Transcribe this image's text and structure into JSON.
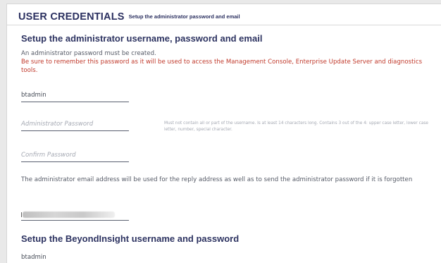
{
  "header": {
    "title": "USER CREDENTIALS",
    "subtitle": "Setup the administrator password and email"
  },
  "admin_section": {
    "heading": "Setup the administrator username, password and email",
    "info": "An administrator password must be created.",
    "warning": "Be sure to remember this password as it will be used to access the Management Console, Enterprise Update Server and diagnostics tools.",
    "username_value": "btadmin",
    "password_placeholder": "Administrator Password",
    "password_hint": "Must not contain all or part of the username. Is at least 14 characters long. Contains 3 out of the 4: upper case letter, lower case letter, number, special character.",
    "confirm_placeholder": "Confirm Password",
    "email_note": "The administrator email address will be used for the reply address as well as to send the administrator password if it is forgotten"
  },
  "beyondinsight_section": {
    "heading": "Setup the BeyondInsight username and password",
    "username_value": "btadmin"
  }
}
